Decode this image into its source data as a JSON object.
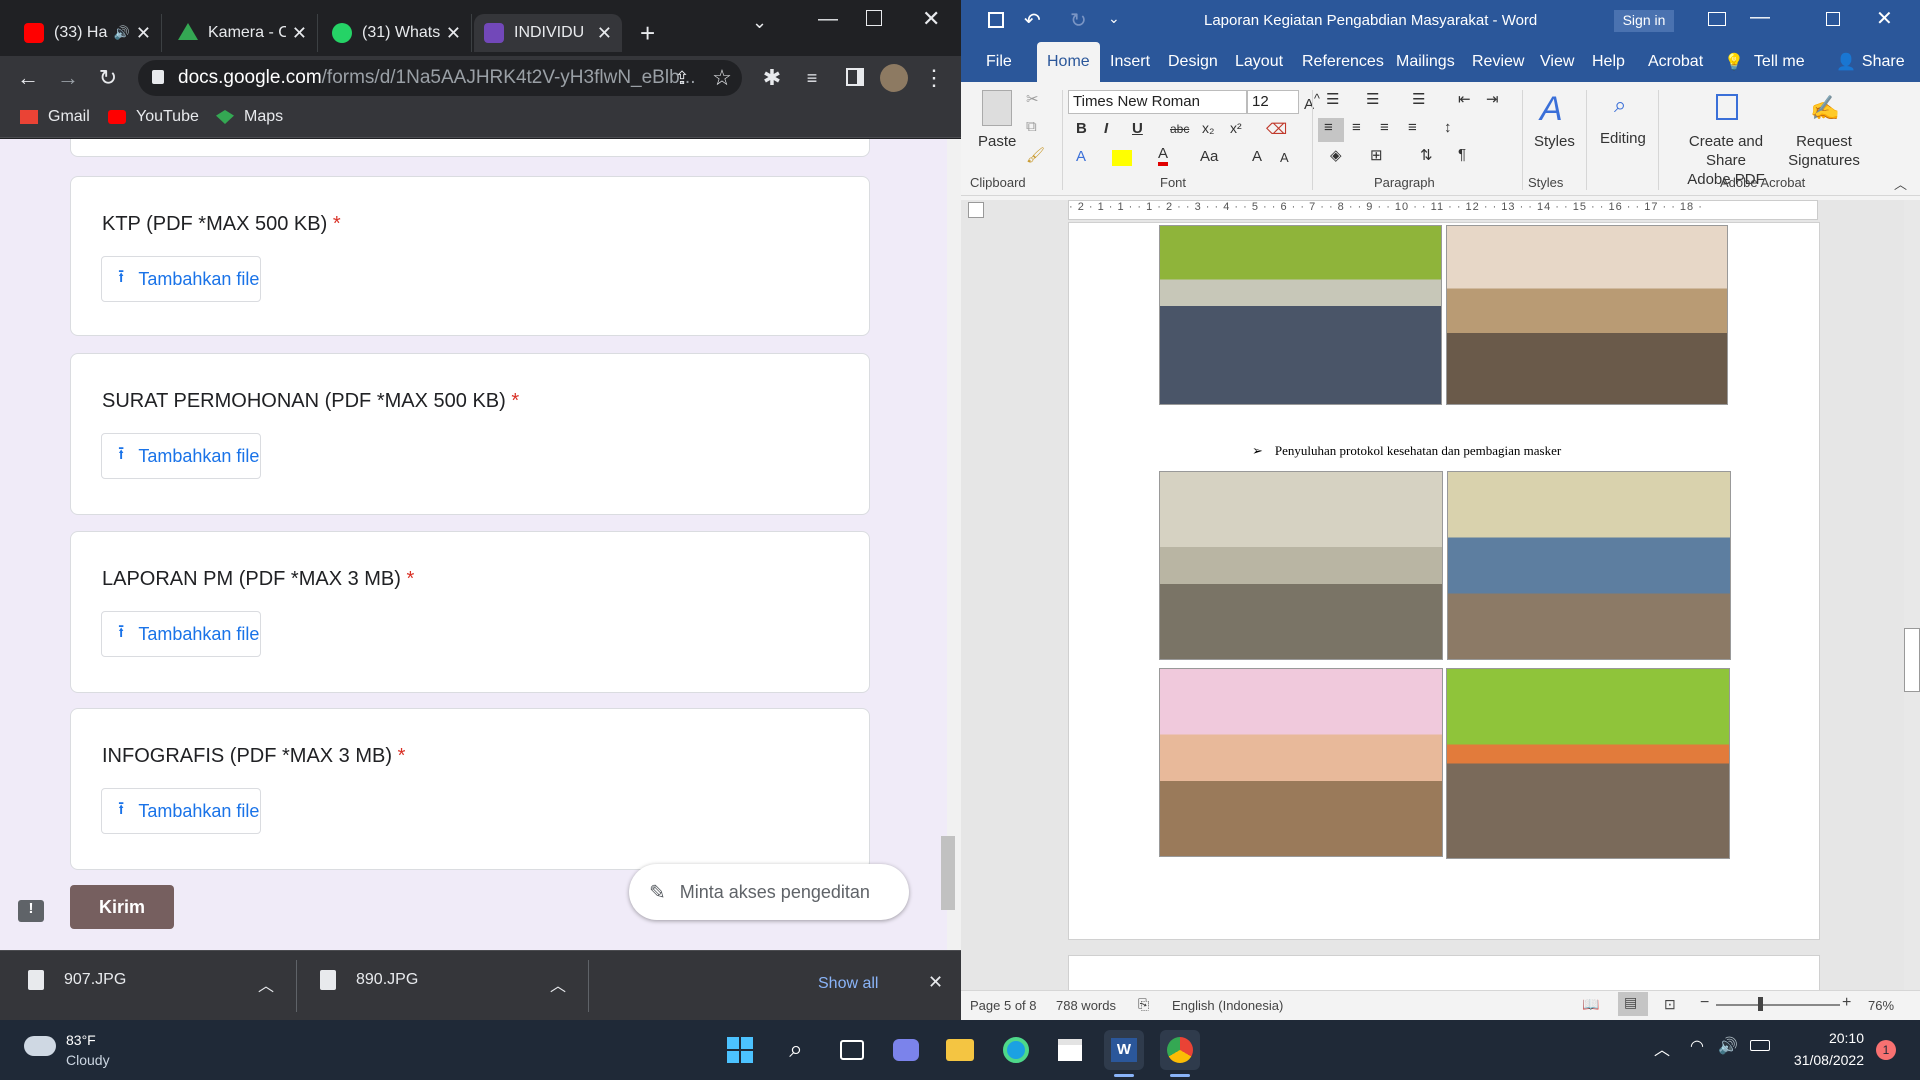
{
  "chrome": {
    "tabs": [
      {
        "label": "(33) Ha",
        "color": "#ff0000"
      },
      {
        "label": "Kamera - C",
        "color": "#34a853"
      },
      {
        "label": "(31) Whats",
        "color": "#25d366"
      },
      {
        "label": "INDIVIDU",
        "color": "#7248b9"
      }
    ],
    "url_host": "docs.google.com",
    "url_path": "/forms/d/1Na5AAJHRK4t2V-yH3flwN_eBlb...",
    "bookmarks": [
      "Gmail",
      "YouTube",
      "Maps"
    ],
    "form": {
      "questions": [
        {
          "title": "KTP (PDF *MAX 500 KB)",
          "required": "*",
          "button": "Tambahkan file"
        },
        {
          "title": "SURAT PERMOHONAN (PDF *MAX 500 KB)",
          "required": "*",
          "button": "Tambahkan file"
        },
        {
          "title": "LAPORAN PM (PDF *MAX 3 MB)",
          "required": "*",
          "button": "Tambahkan file"
        },
        {
          "title": "INFOGRAFIS (PDF *MAX 3 MB)",
          "required": "*",
          "button": "Tambahkan file"
        }
      ],
      "submit": "Kirim",
      "request_edit": "Minta akses pengeditan"
    },
    "downloads": [
      "907.JPG",
      "890.JPG"
    ],
    "show_all": "Show all"
  },
  "word": {
    "title": "Laporan Kegiatan Pengabdian Masyarakat  -  Word",
    "sign_in": "Sign in",
    "tabs": [
      "File",
      "Home",
      "Insert",
      "Design",
      "Layout",
      "References",
      "Mailings",
      "Review",
      "View",
      "Help",
      "Acrobat"
    ],
    "tell_me": "Tell me",
    "share": "Share",
    "font": "Times New Roman",
    "size": "12",
    "groups": [
      "Clipboard",
      "Font",
      "Paragraph",
      "Styles",
      "Adobe Acrobat"
    ],
    "paste": "Paste",
    "styles": "Styles",
    "editing": "Editing",
    "create_share_1": "Create and Share",
    "create_share_2": "Adobe PDF",
    "request_1": "Request",
    "request_2": "Signatures",
    "ruler": "· 2 · 1 · 1 · · 1 · 2 · · 3 · · 4 · · 5 · · 6 · · 7 · · 8 · · 9 · · 10 · · 11 · · 12 · · 13 · · 14 · · 15 · · 16 · · 17 · · 18 ·",
    "bullet_text": "Penyuluhan protokol kesehatan dan pembagian masker",
    "status": {
      "page": "Page 5 of 8",
      "words": "788 words",
      "lang": "English (Indonesia)",
      "zoom": "76%"
    }
  },
  "taskbar": {
    "temp": "83°F",
    "weather": "Cloudy",
    "time": "20:10",
    "date": "31/08/2022",
    "notif": "1"
  }
}
